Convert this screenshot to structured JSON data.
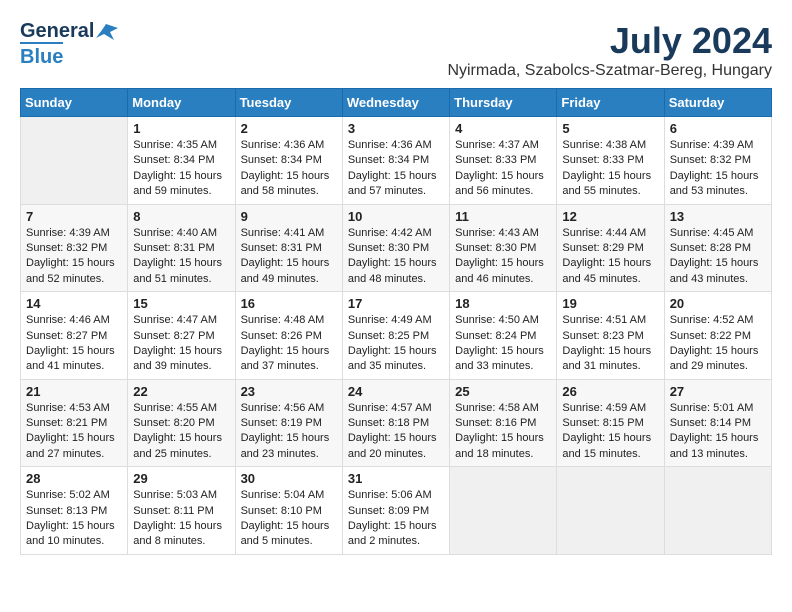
{
  "header": {
    "logo_line1": "General",
    "logo_line2": "Blue",
    "month": "July 2024",
    "location": "Nyirmada, Szabolcs-Szatmar-Bereg, Hungary"
  },
  "weekdays": [
    "Sunday",
    "Monday",
    "Tuesday",
    "Wednesday",
    "Thursday",
    "Friday",
    "Saturday"
  ],
  "weeks": [
    [
      {
        "day": "",
        "sunrise": "",
        "sunset": "",
        "daylight": ""
      },
      {
        "day": "1",
        "sunrise": "Sunrise: 4:35 AM",
        "sunset": "Sunset: 8:34 PM",
        "daylight": "Daylight: 15 hours and 59 minutes."
      },
      {
        "day": "2",
        "sunrise": "Sunrise: 4:36 AM",
        "sunset": "Sunset: 8:34 PM",
        "daylight": "Daylight: 15 hours and 58 minutes."
      },
      {
        "day": "3",
        "sunrise": "Sunrise: 4:36 AM",
        "sunset": "Sunset: 8:34 PM",
        "daylight": "Daylight: 15 hours and 57 minutes."
      },
      {
        "day": "4",
        "sunrise": "Sunrise: 4:37 AM",
        "sunset": "Sunset: 8:33 PM",
        "daylight": "Daylight: 15 hours and 56 minutes."
      },
      {
        "day": "5",
        "sunrise": "Sunrise: 4:38 AM",
        "sunset": "Sunset: 8:33 PM",
        "daylight": "Daylight: 15 hours and 55 minutes."
      },
      {
        "day": "6",
        "sunrise": "Sunrise: 4:39 AM",
        "sunset": "Sunset: 8:32 PM",
        "daylight": "Daylight: 15 hours and 53 minutes."
      }
    ],
    [
      {
        "day": "7",
        "sunrise": "Sunrise: 4:39 AM",
        "sunset": "Sunset: 8:32 PM",
        "daylight": "Daylight: 15 hours and 52 minutes."
      },
      {
        "day": "8",
        "sunrise": "Sunrise: 4:40 AM",
        "sunset": "Sunset: 8:31 PM",
        "daylight": "Daylight: 15 hours and 51 minutes."
      },
      {
        "day": "9",
        "sunrise": "Sunrise: 4:41 AM",
        "sunset": "Sunset: 8:31 PM",
        "daylight": "Daylight: 15 hours and 49 minutes."
      },
      {
        "day": "10",
        "sunrise": "Sunrise: 4:42 AM",
        "sunset": "Sunset: 8:30 PM",
        "daylight": "Daylight: 15 hours and 48 minutes."
      },
      {
        "day": "11",
        "sunrise": "Sunrise: 4:43 AM",
        "sunset": "Sunset: 8:30 PM",
        "daylight": "Daylight: 15 hours and 46 minutes."
      },
      {
        "day": "12",
        "sunrise": "Sunrise: 4:44 AM",
        "sunset": "Sunset: 8:29 PM",
        "daylight": "Daylight: 15 hours and 45 minutes."
      },
      {
        "day": "13",
        "sunrise": "Sunrise: 4:45 AM",
        "sunset": "Sunset: 8:28 PM",
        "daylight": "Daylight: 15 hours and 43 minutes."
      }
    ],
    [
      {
        "day": "14",
        "sunrise": "Sunrise: 4:46 AM",
        "sunset": "Sunset: 8:27 PM",
        "daylight": "Daylight: 15 hours and 41 minutes."
      },
      {
        "day": "15",
        "sunrise": "Sunrise: 4:47 AM",
        "sunset": "Sunset: 8:27 PM",
        "daylight": "Daylight: 15 hours and 39 minutes."
      },
      {
        "day": "16",
        "sunrise": "Sunrise: 4:48 AM",
        "sunset": "Sunset: 8:26 PM",
        "daylight": "Daylight: 15 hours and 37 minutes."
      },
      {
        "day": "17",
        "sunrise": "Sunrise: 4:49 AM",
        "sunset": "Sunset: 8:25 PM",
        "daylight": "Daylight: 15 hours and 35 minutes."
      },
      {
        "day": "18",
        "sunrise": "Sunrise: 4:50 AM",
        "sunset": "Sunset: 8:24 PM",
        "daylight": "Daylight: 15 hours and 33 minutes."
      },
      {
        "day": "19",
        "sunrise": "Sunrise: 4:51 AM",
        "sunset": "Sunset: 8:23 PM",
        "daylight": "Daylight: 15 hours and 31 minutes."
      },
      {
        "day": "20",
        "sunrise": "Sunrise: 4:52 AM",
        "sunset": "Sunset: 8:22 PM",
        "daylight": "Daylight: 15 hours and 29 minutes."
      }
    ],
    [
      {
        "day": "21",
        "sunrise": "Sunrise: 4:53 AM",
        "sunset": "Sunset: 8:21 PM",
        "daylight": "Daylight: 15 hours and 27 minutes."
      },
      {
        "day": "22",
        "sunrise": "Sunrise: 4:55 AM",
        "sunset": "Sunset: 8:20 PM",
        "daylight": "Daylight: 15 hours and 25 minutes."
      },
      {
        "day": "23",
        "sunrise": "Sunrise: 4:56 AM",
        "sunset": "Sunset: 8:19 PM",
        "daylight": "Daylight: 15 hours and 23 minutes."
      },
      {
        "day": "24",
        "sunrise": "Sunrise: 4:57 AM",
        "sunset": "Sunset: 8:18 PM",
        "daylight": "Daylight: 15 hours and 20 minutes."
      },
      {
        "day": "25",
        "sunrise": "Sunrise: 4:58 AM",
        "sunset": "Sunset: 8:16 PM",
        "daylight": "Daylight: 15 hours and 18 minutes."
      },
      {
        "day": "26",
        "sunrise": "Sunrise: 4:59 AM",
        "sunset": "Sunset: 8:15 PM",
        "daylight": "Daylight: 15 hours and 15 minutes."
      },
      {
        "day": "27",
        "sunrise": "Sunrise: 5:01 AM",
        "sunset": "Sunset: 8:14 PM",
        "daylight": "Daylight: 15 hours and 13 minutes."
      }
    ],
    [
      {
        "day": "28",
        "sunrise": "Sunrise: 5:02 AM",
        "sunset": "Sunset: 8:13 PM",
        "daylight": "Daylight: 15 hours and 10 minutes."
      },
      {
        "day": "29",
        "sunrise": "Sunrise: 5:03 AM",
        "sunset": "Sunset: 8:11 PM",
        "daylight": "Daylight: 15 hours and 8 minutes."
      },
      {
        "day": "30",
        "sunrise": "Sunrise: 5:04 AM",
        "sunset": "Sunset: 8:10 PM",
        "daylight": "Daylight: 15 hours and 5 minutes."
      },
      {
        "day": "31",
        "sunrise": "Sunrise: 5:06 AM",
        "sunset": "Sunset: 8:09 PM",
        "daylight": "Daylight: 15 hours and 2 minutes."
      },
      {
        "day": "",
        "sunrise": "",
        "sunset": "",
        "daylight": ""
      },
      {
        "day": "",
        "sunrise": "",
        "sunset": "",
        "daylight": ""
      },
      {
        "day": "",
        "sunrise": "",
        "sunset": "",
        "daylight": ""
      }
    ]
  ]
}
